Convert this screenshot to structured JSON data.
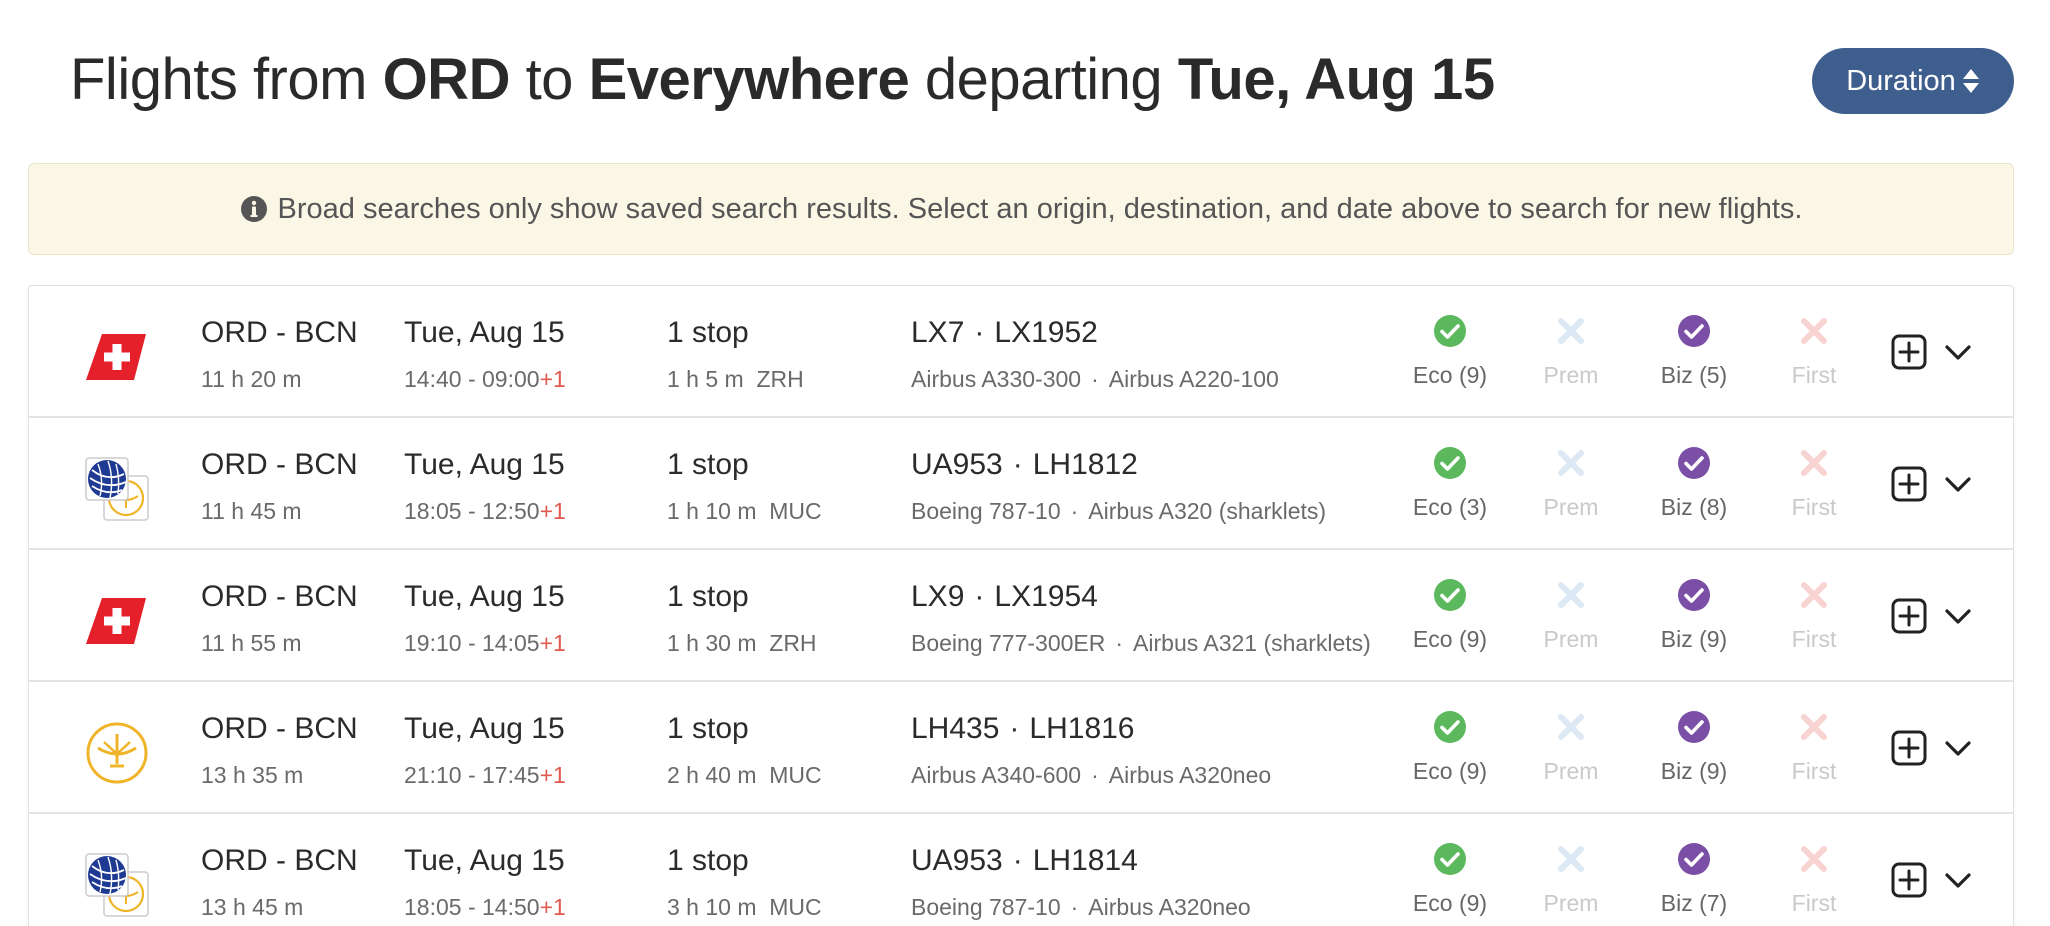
{
  "header": {
    "t1": "Flights from ",
    "origin": "ORD",
    "t2": " to ",
    "destination": "Everywhere",
    "t3": " departing ",
    "date": "Tue, Aug 15",
    "sort_label": "Duration"
  },
  "notice": {
    "text": "Broad searches only show saved search results. Select an origin, destination, and date above to search for new flights."
  },
  "cabin_labels": {
    "eco": "Eco",
    "prem": "Prem",
    "biz": "Biz",
    "first": "First"
  },
  "colors": {
    "sort_button": "#3e5f8e",
    "eco_check": "#5cb85c",
    "biz_check": "#7b4fa6",
    "prem_x": "#dce9f5",
    "first_x": "#f7d3d1",
    "next_day": "#e15a4f",
    "notice_bg": "#fbf7e6"
  },
  "flights": [
    {
      "airline_icon": "swiss-logo-icon",
      "route": "ORD - BCN",
      "duration": "11 h 20 m",
      "date": "Tue, Aug 15",
      "times": "14:40 - 09:00",
      "plus": "+1",
      "stops": "1 stop",
      "layover": "1 h 5 m  ZRH",
      "flight1": "LX7",
      "flight2": "LX1952",
      "aircraft1": "Airbus A330-300",
      "aircraft2": "Airbus A220-100",
      "eco": "Eco (9)",
      "prem": "Prem",
      "biz": "Biz (5)",
      "first": "First"
    },
    {
      "airline_icon": "united-lufthansa-logo-icon",
      "route": "ORD - BCN",
      "duration": "11 h 45 m",
      "date": "Tue, Aug 15",
      "times": "18:05 - 12:50",
      "plus": "+1",
      "stops": "1 stop",
      "layover": "1 h 10 m  MUC",
      "flight1": "UA953",
      "flight2": "LH1812",
      "aircraft1": "Boeing 787-10",
      "aircraft2": "Airbus A320 (sharklets)",
      "eco": "Eco (3)",
      "prem": "Prem",
      "biz": "Biz (8)",
      "first": "First"
    },
    {
      "airline_icon": "swiss-logo-icon",
      "route": "ORD - BCN",
      "duration": "11 h 55 m",
      "date": "Tue, Aug 15",
      "times": "19:10 - 14:05",
      "plus": "+1",
      "stops": "1 stop",
      "layover": "1 h 30 m  ZRH",
      "flight1": "LX9",
      "flight2": "LX1954",
      "aircraft1": "Boeing 777-300ER",
      "aircraft2": "Airbus A321 (sharklets)",
      "eco": "Eco (9)",
      "prem": "Prem",
      "biz": "Biz (9)",
      "first": "First"
    },
    {
      "airline_icon": "lufthansa-logo-icon",
      "route": "ORD - BCN",
      "duration": "13 h 35 m",
      "date": "Tue, Aug 15",
      "times": "21:10 - 17:45",
      "plus": "+1",
      "stops": "1 stop",
      "layover": "2 h 40 m  MUC",
      "flight1": "LH435",
      "flight2": "LH1816",
      "aircraft1": "Airbus A340-600",
      "aircraft2": "Airbus A320neo",
      "eco": "Eco (9)",
      "prem": "Prem",
      "biz": "Biz (9)",
      "first": "First"
    },
    {
      "airline_icon": "united-lufthansa-logo-icon",
      "route": "ORD - BCN",
      "duration": "13 h 45 m",
      "date": "Tue, Aug 15",
      "times": "18:05 - 14:50",
      "plus": "+1",
      "stops": "1 stop",
      "layover": "3 h 10 m  MUC",
      "flight1": "UA953",
      "flight2": "LH1814",
      "aircraft1": "Boeing 787-10",
      "aircraft2": "Airbus A320neo",
      "eco": "Eco (9)",
      "prem": "Prem",
      "biz": "Biz (7)",
      "first": "First"
    }
  ]
}
